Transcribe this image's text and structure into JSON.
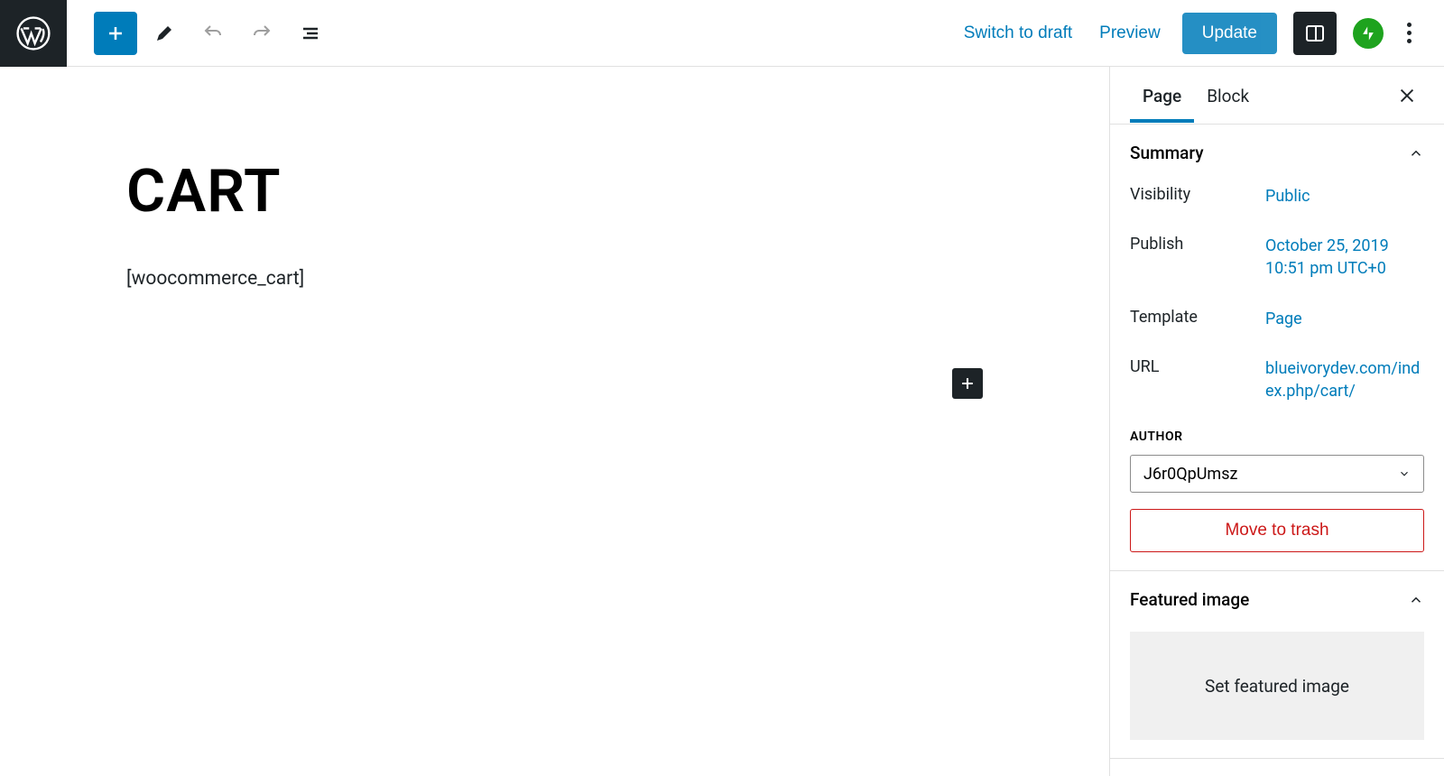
{
  "topbar": {
    "switch_to_draft": "Switch to draft",
    "preview": "Preview",
    "update": "Update"
  },
  "editor": {
    "title": "CART",
    "content": "[woocommerce_cart]"
  },
  "sidebar": {
    "tabs": {
      "page": "Page",
      "block": "Block"
    },
    "summary": {
      "heading": "Summary",
      "rows": {
        "visibility_label": "Visibility",
        "visibility_value": "Public",
        "publish_label": "Publish",
        "publish_value": "October 25, 2019 10:51 pm UTC+0",
        "template_label": "Template",
        "template_value": "Page",
        "url_label": "URL",
        "url_value": "blueivorydev.com/index.php/cart/"
      },
      "author_label": "AUTHOR",
      "author_value": "J6r0QpUmsz",
      "trash": "Move to trash"
    },
    "featured": {
      "heading": "Featured image",
      "set": "Set featured image"
    }
  }
}
